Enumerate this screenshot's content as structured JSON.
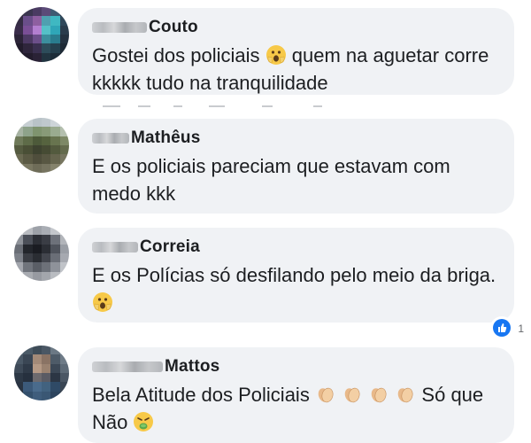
{
  "comments": [
    {
      "name": "Couto",
      "text_before": "Gostei dos policiais ",
      "text_after": " quem na aguetar corre kkkkk tudo na tranquilidade",
      "emoji": "shocked-face"
    },
    {
      "name": "Mathêus",
      "text": "E os policiais pareciam que estavam com medo kkk"
    },
    {
      "name": "Correia",
      "text_before": "E os Polícias só desfilando pelo meio da briga.",
      "emoji": "shocked-face"
    },
    {
      "name": "Mattos",
      "text_before": "Bela Atitude dos Policiais ",
      "text_mid": " Só que Não ",
      "emoji_claps": 4,
      "emoji_end": "nauseated-face"
    }
  ],
  "reaction": {
    "icon": "like-icon",
    "count": "1"
  },
  "colors": {
    "bubble": "#f0f2f5",
    "text": "#1c1e21",
    "like": "#1877f2"
  }
}
